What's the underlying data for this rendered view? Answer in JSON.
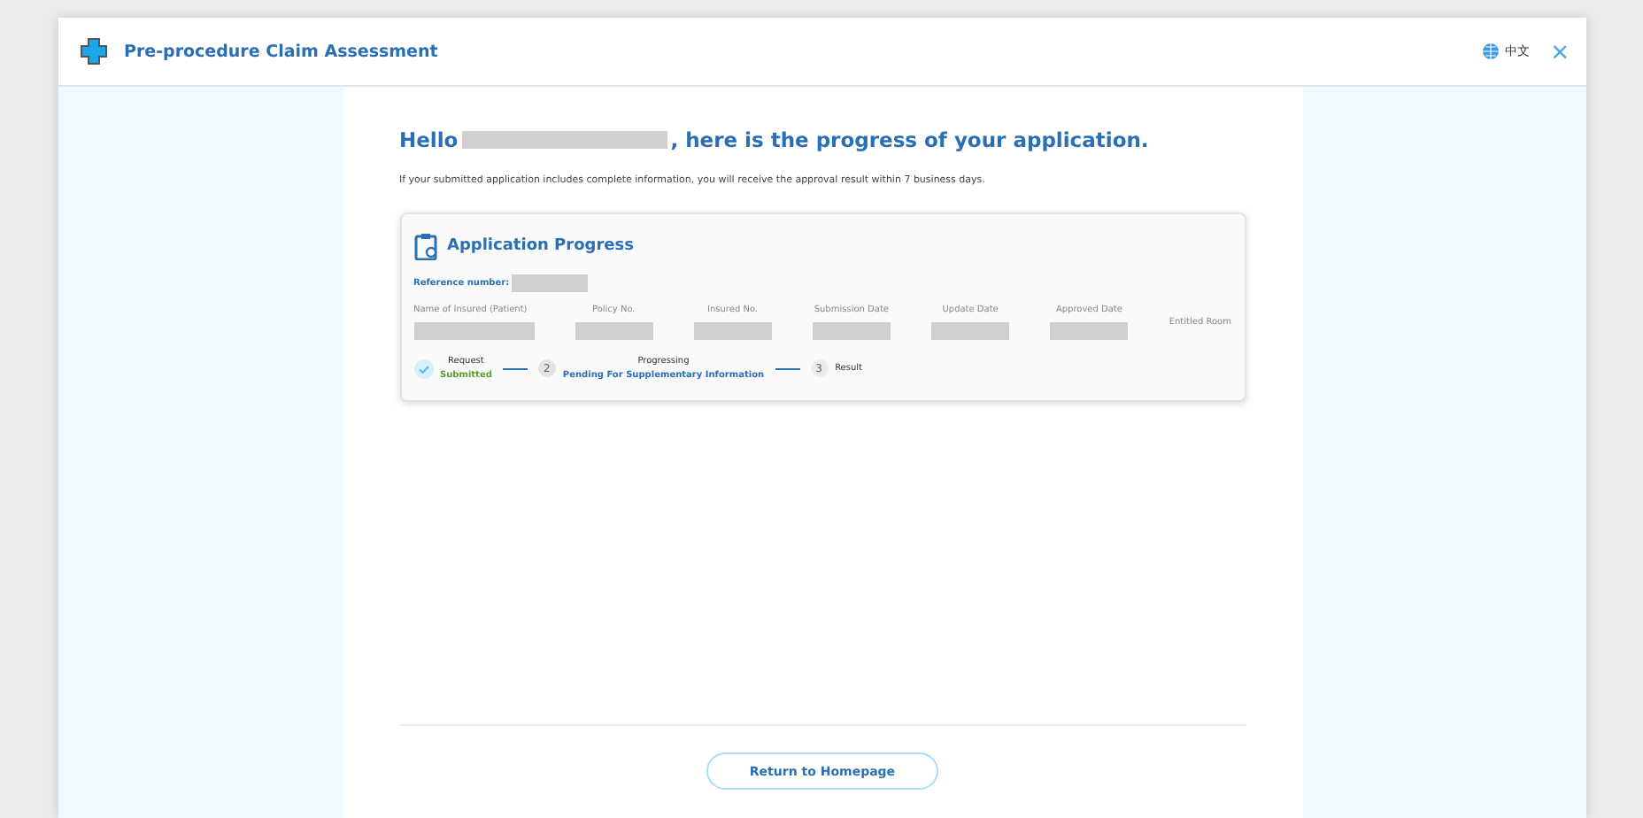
{
  "window": {
    "title": "Pre-procedure Claim Assessment",
    "language": "中文",
    "close": "×"
  },
  "greeting": {
    "before": "Hello",
    "after": ", here is the progress of your application."
  },
  "notice": "If your submitted application includes complete information, you will receive the approval result within 7 business days.",
  "card": {
    "title": "Application Progress",
    "reference_label": "Reference number:",
    "fields": [
      {
        "label": "Name of Insured (Patient)",
        "redacted": true
      },
      {
        "label": "Policy No.",
        "redacted": true
      },
      {
        "label": "Insured No.",
        "redacted": true
      },
      {
        "label": "Submission Date",
        "redacted": true
      },
      {
        "label": "Update Date",
        "redacted": true
      },
      {
        "label": "Approved Date",
        "redacted": true
      },
      {
        "label": "Entitled Room",
        "redacted": false
      }
    ],
    "steps": [
      {
        "kind": "done",
        "title": "Request",
        "status": "Submitted"
      },
      {
        "kind": "current",
        "number": "2",
        "title": "Progressing",
        "status": "Pending For Supplementary Information"
      },
      {
        "kind": "pending",
        "number": "3",
        "title": "Result"
      }
    ]
  },
  "button": "Return to Homepage"
}
